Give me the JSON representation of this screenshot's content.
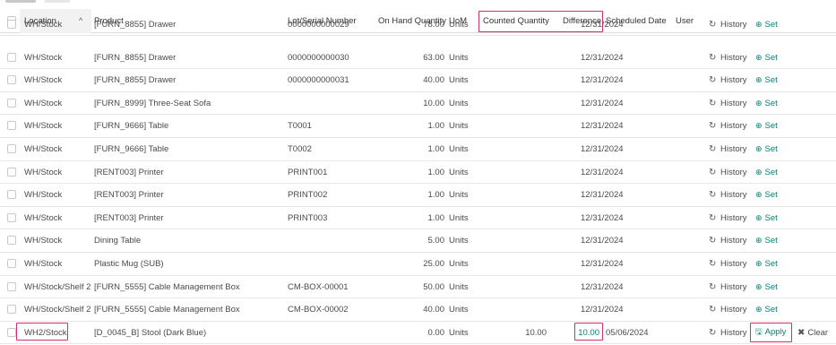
{
  "header": {
    "location": "Location",
    "product": "Product",
    "lot": "Lot/Serial Number",
    "on_hand": "On Hand Quantity",
    "uom": "UoM",
    "counted": "Counted Quantity",
    "difference": "Difference",
    "scheduled": "Scheduled Date",
    "user": "User"
  },
  "actions": {
    "history": "History",
    "set": "Set",
    "apply": "Apply",
    "clear": "Clear"
  },
  "rows": [
    {
      "location": "WH/Stock",
      "product": "[FURN_8855] Drawer",
      "lot": "0000000000029",
      "on_hand": "78.00",
      "uom": "Units",
      "counted": "",
      "difference": "",
      "date": "12/31/2024"
    },
    {
      "location": "WH/Stock",
      "product": "[FURN_8855] Drawer",
      "lot": "0000000000030",
      "on_hand": "63.00",
      "uom": "Units",
      "counted": "",
      "difference": "",
      "date": "12/31/2024"
    },
    {
      "location": "WH/Stock",
      "product": "[FURN_8855] Drawer",
      "lot": "0000000000031",
      "on_hand": "40.00",
      "uom": "Units",
      "counted": "",
      "difference": "",
      "date": "12/31/2024"
    },
    {
      "location": "WH/Stock",
      "product": "[FURN_8999] Three-Seat Sofa",
      "lot": "",
      "on_hand": "10.00",
      "uom": "Units",
      "counted": "",
      "difference": "",
      "date": "12/31/2024"
    },
    {
      "location": "WH/Stock",
      "product": "[FURN_9666] Table",
      "lot": "T0001",
      "on_hand": "1.00",
      "uom": "Units",
      "counted": "",
      "difference": "",
      "date": "12/31/2024"
    },
    {
      "location": "WH/Stock",
      "product": "[FURN_9666] Table",
      "lot": "T0002",
      "on_hand": "1.00",
      "uom": "Units",
      "counted": "",
      "difference": "",
      "date": "12/31/2024"
    },
    {
      "location": "WH/Stock",
      "product": "[RENT003] Printer",
      "lot": "PRINT001",
      "on_hand": "1.00",
      "uom": "Units",
      "counted": "",
      "difference": "",
      "date": "12/31/2024"
    },
    {
      "location": "WH/Stock",
      "product": "[RENT003] Printer",
      "lot": "PRINT002",
      "on_hand": "1.00",
      "uom": "Units",
      "counted": "",
      "difference": "",
      "date": "12/31/2024"
    },
    {
      "location": "WH/Stock",
      "product": "[RENT003] Printer",
      "lot": "PRINT003",
      "on_hand": "1.00",
      "uom": "Units",
      "counted": "",
      "difference": "",
      "date": "12/31/2024"
    },
    {
      "location": "WH/Stock",
      "product": "Dining Table",
      "lot": "",
      "on_hand": "5.00",
      "uom": "Units",
      "counted": "",
      "difference": "",
      "date": "12/31/2024"
    },
    {
      "location": "WH/Stock",
      "product": "Plastic Mug (SUB)",
      "lot": "",
      "on_hand": "25.00",
      "uom": "Units",
      "counted": "",
      "difference": "",
      "date": "12/31/2024"
    },
    {
      "location": "WH/Stock/Shelf 2",
      "product": "[FURN_5555] Cable Management Box",
      "lot": "CM-BOX-00001",
      "on_hand": "50.00",
      "uom": "Units",
      "counted": "",
      "difference": "",
      "date": "12/31/2024"
    },
    {
      "location": "WH/Stock/Shelf 2",
      "product": "[FURN_5555] Cable Management Box",
      "lot": "CM-BOX-00002",
      "on_hand": "40.00",
      "uom": "Units",
      "counted": "",
      "difference": "",
      "date": "12/31/2024"
    },
    {
      "location": "WH2/Stock",
      "product": "[D_0045_B] Stool (Dark Blue)",
      "lot": "",
      "on_hand": "0.00",
      "uom": "Units",
      "counted": "10.00",
      "difference": "10.00",
      "date": "05/06/2024"
    }
  ],
  "colors": {
    "highlight": "#d1306a",
    "accent": "#0b7d72"
  },
  "icons": {
    "history": "history-icon",
    "set": "target-icon",
    "apply": "save-icon",
    "clear": "close-icon",
    "sort": "chevron-up-icon"
  }
}
